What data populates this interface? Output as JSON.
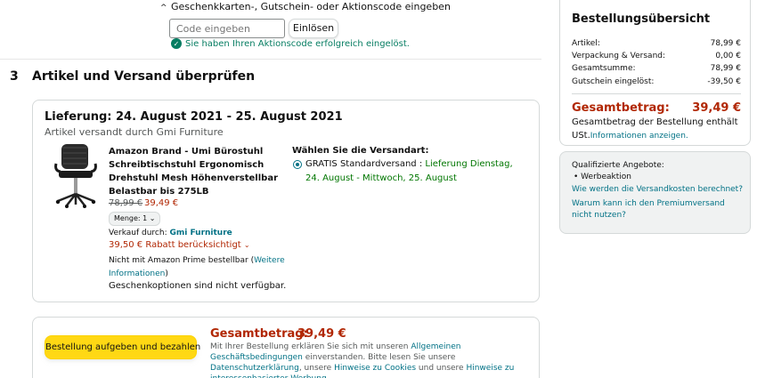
{
  "promo": {
    "toggle_label": "Geschenkkarten-, Gutschein- oder Aktionscode eingeben",
    "input_placeholder": "Code eingeben",
    "apply_button": "Einlösen",
    "success_message": "Sie haben Ihren Aktionscode erfolgreich eingelöst."
  },
  "step": {
    "number": "3",
    "title": "Artikel und Versand überprüfen"
  },
  "delivery": {
    "title": "Lieferung: 24. August 2021 - 25. August 2021",
    "shipped_by": "Artikel versandt durch Gmi Furniture"
  },
  "product": {
    "name": "Amazon Brand - Umi Bürostuhl Schreibtischstuhl Ergonomisch Drehstuhl Mesh Höhenverstellbar Belastbar bis 275LB",
    "price_old": "78,99 €",
    "price_new": "39,49 €",
    "quantity_label": "Menge: 1",
    "seller_label": "Verkauf durch:",
    "seller_name": "Gmi Furniture",
    "discount": "39,50 € Rabatt berücksichtigt",
    "prime_note": "Nicht mit Amazon Prime bestellbar (",
    "prime_link": "Weitere Informationen",
    "prime_close": ")",
    "gift_note": "Geschenkoptionen sind nicht verfügbar."
  },
  "shipping": {
    "title": "Wählen Sie die Versandart:",
    "option_label": "GRATIS Standardversand : ",
    "option_detail": "Lieferung Dienstag, 24. August - Mittwoch, 25. August"
  },
  "order": {
    "button": "Bestellung aufgeben und bezahlen",
    "total_label": "Gesamtbetrag:",
    "total_value": "39,49 €",
    "legal_1": "Mit Ihrer Bestellung erklären Sie sich mit unseren ",
    "legal_link_1": "Allgemeinen Geschäftsbedingungen",
    "legal_2": " einverstanden. Bitte lesen Sie unsere ",
    "legal_link_2": "Datenschutzerklärung",
    "legal_3": ", unsere ",
    "legal_link_3": "Hinweise zu Cookies",
    "legal_4": " und unsere ",
    "legal_link_4": "Hinweise zu interessenbasierter Werbung"
  },
  "summary": {
    "title": "Bestellungsübersicht",
    "rows": [
      {
        "label": "Artikel:",
        "value": "78,99 €"
      },
      {
        "label": "Verpackung & Versand:",
        "value": "0,00 €"
      },
      {
        "label": "Gesamtsumme:",
        "value": "78,99 €"
      },
      {
        "label": "Gutschein eingelöst:",
        "value": "-39,50 €"
      }
    ],
    "grand_label": "Gesamtbetrag:",
    "grand_value": "39,49 €",
    "vat_text": "Gesamtbetrag der Bestellung enthält USt.",
    "vat_link": "Informationen anzeigen."
  },
  "qualified": {
    "title": "Qualifizierte Angebote:",
    "item": "Werbeaktion",
    "faq_1": "Wie werden die Versandkosten berechnet?",
    "faq_2": "Warum kann ich den Premiumversand nicht nutzen?"
  },
  "colors": {
    "price_red": "#b12704",
    "link": "#007185",
    "success_green": "#067d62",
    "button_yellow": "#ffd814"
  }
}
